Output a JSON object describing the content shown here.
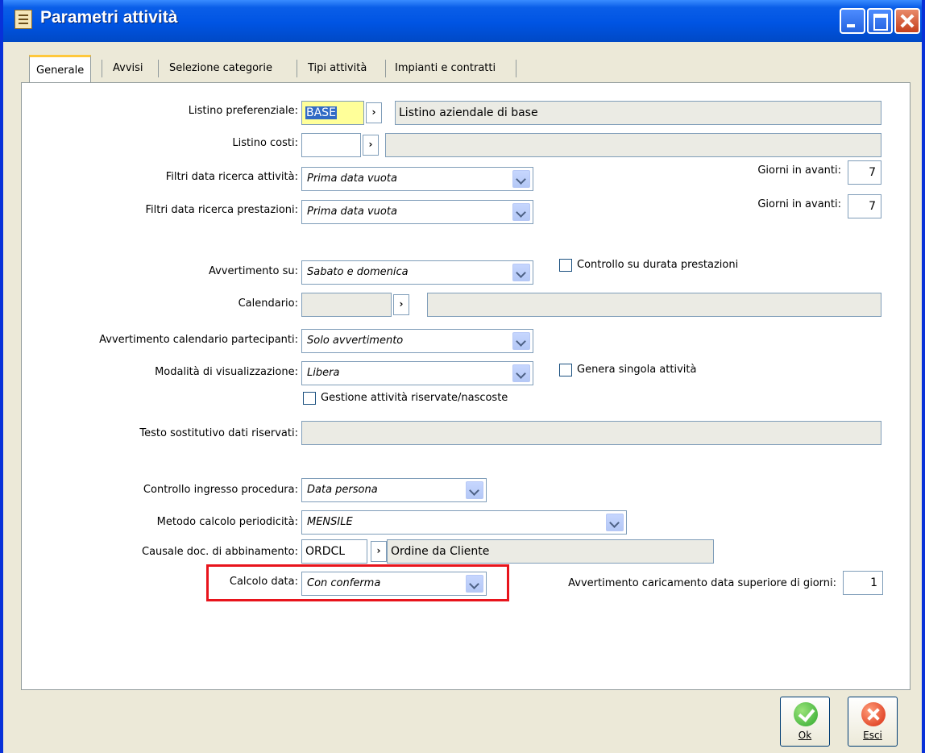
{
  "window": {
    "title": "Parametri attività"
  },
  "tabs": [
    "Generale",
    "Avvisi",
    "Selezione categorie",
    "Tipi attività",
    "Impianti e contratti"
  ],
  "form": {
    "listino_pref": {
      "label": "Listino preferenziale:",
      "code": "BASE",
      "desc": "Listino aziendale di base"
    },
    "listino_costi": {
      "label": "Listino costi:",
      "code": "",
      "desc": ""
    },
    "filtri_attivita": {
      "label": "Filtri data ricerca attività:",
      "value": "Prima data vuota"
    },
    "filtri_prestazioni": {
      "label": "Filtri data ricerca prestazioni:",
      "value": "Prima data vuota"
    },
    "giorni_avanti_1": {
      "label": "Giorni in avanti:",
      "value": "7"
    },
    "giorni_avanti_2": {
      "label": "Giorni in avanti:",
      "value": "7"
    },
    "avvertimento_su": {
      "label": "Avvertimento su:",
      "value": "Sabato e domenica"
    },
    "controllo_durata": {
      "label": "Controllo su durata prestazioni"
    },
    "calendario": {
      "label": "Calendario:",
      "code": "",
      "desc": ""
    },
    "avv_cal_partecipanti": {
      "label": "Avvertimento calendario partecipanti:",
      "value": "Solo avvertimento"
    },
    "modalita_visual": {
      "label": "Modalità di visualizzazione:",
      "value": "Libera"
    },
    "genera_singola": {
      "label": "Genera singola attività"
    },
    "gestione_riservate": {
      "label": "Gestione attività riservate/nascoste"
    },
    "testo_sostitutivo": {
      "label": "Testo sostitutivo dati riservati:",
      "value": ""
    },
    "controllo_ingresso": {
      "label": "Controllo ingresso procedura:",
      "value": "Data persona"
    },
    "metodo_periodicita": {
      "label": "Metodo calcolo periodicità:",
      "value": "MENSILE"
    },
    "causale_doc": {
      "label": "Causale doc. di abbinamento:",
      "code": "ORDCL",
      "desc": "Ordine da Cliente"
    },
    "calcolo_data": {
      "label": "Calcolo data:",
      "value": "Con conferma"
    },
    "avv_caricamento": {
      "label": "Avvertimento caricamento data superiore di giorni:",
      "value": "1"
    }
  },
  "buttons": {
    "ok": "Ok",
    "esci": "Esci"
  },
  "colors": {
    "title_bar": "#0054e3",
    "highlight_box": "#e8141c",
    "tab_accent": "#ffc83c"
  }
}
